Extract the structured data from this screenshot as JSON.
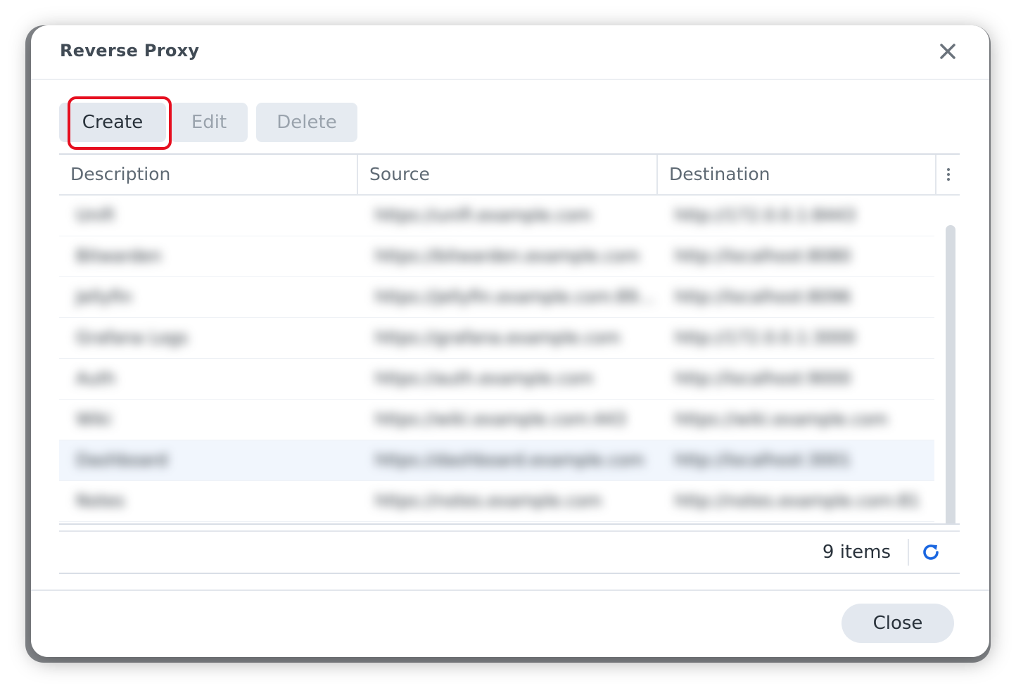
{
  "dialog": {
    "title": "Reverse Proxy",
    "close_icon": "close-icon"
  },
  "toolbar": {
    "create_label": "Create",
    "edit_label": "Edit",
    "delete_label": "Delete",
    "highlight_color": "#e60e1f"
  },
  "grid": {
    "columns": [
      "Description",
      "Source",
      "Destination"
    ],
    "column_menu_icon": "more-vertical-icon",
    "rows": [
      {
        "description": "Unifi",
        "source": "https://unifi.example.com",
        "destination": "http://172.0.0.1:8443"
      },
      {
        "description": "Bitwarden",
        "source": "https://bitwarden.example.com",
        "destination": "http://localhost:8080"
      },
      {
        "description": "Jellyfin",
        "source": "https://jellyfin.example.com:8920",
        "destination": "http://localhost:8096"
      },
      {
        "description": "Grafana Logs",
        "source": "https://grafana.example.com",
        "destination": "http://172.0.0.1:3000"
      },
      {
        "description": "Auth",
        "source": "https://auth.example.com",
        "destination": "http://localhost:9000"
      },
      {
        "description": "Wiki",
        "source": "https://wiki.example.com:443",
        "destination": "https://wiki.example.com"
      },
      {
        "description": "Dashboard",
        "source": "https://dashboard.example.com",
        "destination": "http://localhost:3001"
      },
      {
        "description": "Notes",
        "source": "https://notes.example.com",
        "destination": "http://notes.example.com:81"
      }
    ],
    "selected_row_index": 6
  },
  "footer": {
    "items_count": "9 items",
    "refresh_icon": "refresh-icon",
    "accent_color": "#1a66e0"
  },
  "actions": {
    "close_label": "Close"
  }
}
